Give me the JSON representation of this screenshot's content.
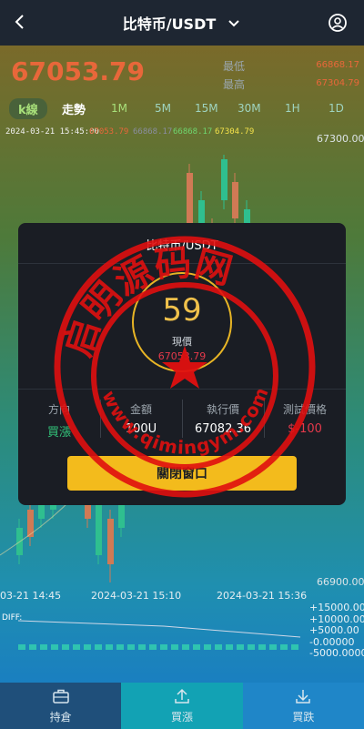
{
  "header": {
    "title": "比特币/USDT"
  },
  "ticker": {
    "price": "67053.79",
    "low_label": "最低",
    "low_value": "66868.17",
    "high_label": "最高",
    "high_value": "67304.79"
  },
  "tabs": {
    "kline": "k線",
    "trend": "走勢",
    "intervals": [
      "1M",
      "5M",
      "15M",
      "30M",
      "1H",
      "1D"
    ]
  },
  "info": {
    "datetime": "2024-03-21 15:45:00",
    "open": "67053.79",
    "close": "66868.17",
    "low": "66868.17",
    "high": "67304.79"
  },
  "chart": {
    "y_labels": [
      "67300.00",
      "66900.00"
    ],
    "x_labels": [
      "03-21 14:45",
      "2024-03-21 15:10",
      "2024-03-21 15:36"
    ],
    "diff_label": "DIFF:",
    "diff_axis": [
      "+15000.00",
      "+10000.00",
      "+5000.00",
      "-0.00000",
      "-5000.0000"
    ],
    "colors": {
      "up": "#2fbf8f",
      "down": "#d07a55"
    }
  },
  "modal": {
    "title": "比特币/USDT",
    "countdown": "59",
    "current_label": "現價",
    "current_value": "67053.79",
    "cols": [
      {
        "label": "方向",
        "value": "買漲"
      },
      {
        "label": "金額",
        "value": "100U"
      },
      {
        "label": "執行價",
        "value": "67082.36"
      },
      {
        "label": "測試價格",
        "value": "$-100"
      }
    ],
    "close_button": "關閉窗口"
  },
  "watermark": {
    "text": "启明源码网",
    "url": "www.qimingym.com"
  },
  "bottom_nav": [
    {
      "label": "持倉",
      "icon": "briefcase-icon"
    },
    {
      "label": "買漲",
      "icon": "upload-icon"
    },
    {
      "label": "買跌",
      "icon": "download-icon"
    }
  ]
}
